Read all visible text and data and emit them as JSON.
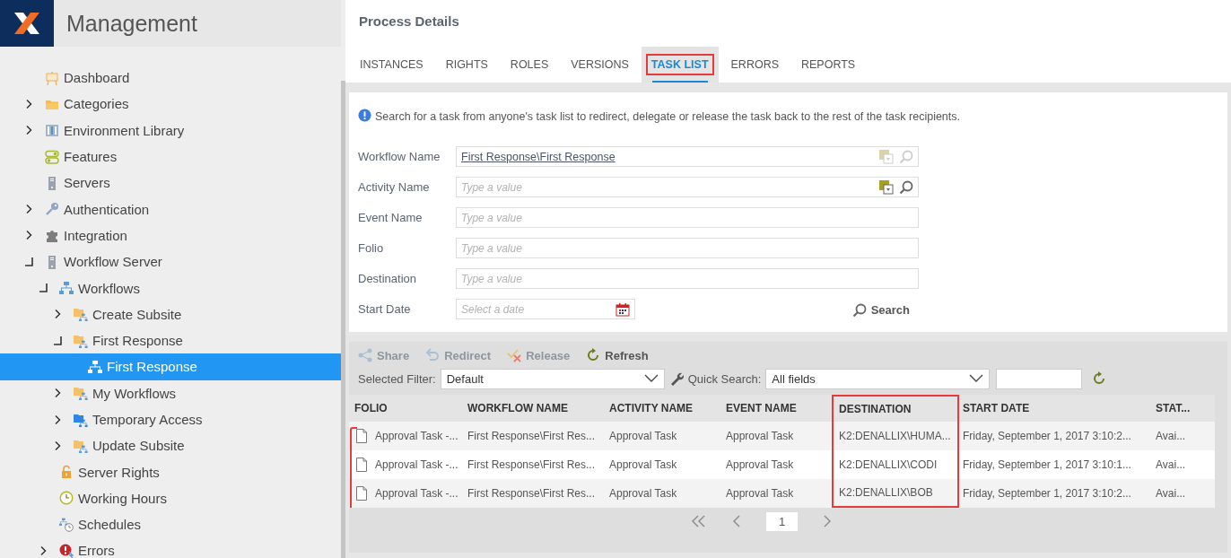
{
  "sidebar": {
    "title": "Management",
    "tree": [
      {
        "label": "Dashboard",
        "kind": "dashboard",
        "selected": false
      },
      {
        "label": "Categories",
        "kind": "folder",
        "selected": false,
        "expanded": false
      },
      {
        "label": "Environment Library",
        "kind": "library",
        "selected": false,
        "expanded": false
      },
      {
        "label": "Features",
        "kind": "toggles",
        "selected": false
      },
      {
        "label": "Servers",
        "kind": "server",
        "selected": false
      },
      {
        "label": "Authentication",
        "kind": "key",
        "selected": false,
        "expanded": false
      },
      {
        "label": "Integration",
        "kind": "puzzle",
        "selected": false,
        "expanded": false
      },
      {
        "label": "Workflow Server",
        "kind": "server",
        "selected": false,
        "expanded": true,
        "children": [
          {
            "label": "Workflows",
            "kind": "workflow",
            "selected": false,
            "expanded": true,
            "children": [
              {
                "label": "Create Subsite",
                "kind": "workflow-folder",
                "selected": false,
                "expanded": false
              },
              {
                "label": "First Response",
                "kind": "workflow-folder",
                "selected": false,
                "expanded": true,
                "children": [
                  {
                    "label": "First Response",
                    "kind": "workflow",
                    "selected": true
                  }
                ]
              },
              {
                "label": "My Workflows",
                "kind": "workflow-folder",
                "selected": false,
                "expanded": false
              },
              {
                "label": "Temporary Access",
                "kind": "workflow-folder-blue",
                "selected": false,
                "expanded": false
              },
              {
                "label": "Update Subsite",
                "kind": "workflow-folder",
                "selected": false,
                "expanded": false
              }
            ]
          },
          {
            "label": "Server Rights",
            "kind": "lock",
            "selected": false
          },
          {
            "label": "Working Hours",
            "kind": "clock",
            "selected": false
          },
          {
            "label": "Schedules",
            "kind": "schedule",
            "selected": false
          },
          {
            "label": "Errors",
            "kind": "error",
            "selected": false,
            "expanded": false
          }
        ]
      }
    ]
  },
  "page": {
    "title": "Process Details"
  },
  "tabs": [
    {
      "label": "INSTANCES",
      "selected": false
    },
    {
      "label": "RIGHTS",
      "selected": false
    },
    {
      "label": "ROLES",
      "selected": false
    },
    {
      "label": "VERSIONS",
      "selected": false
    },
    {
      "label": "TASK LIST",
      "selected": true
    },
    {
      "label": "ERRORS",
      "selected": false
    },
    {
      "label": "REPORTS",
      "selected": false
    }
  ],
  "search_form": {
    "info": "Search for a task from anyone's task list to redirect, delegate or release the task back to the rest of the task recipients.",
    "fields": [
      {
        "label": "Workflow Name",
        "kind": "picker",
        "value": "First Response\\First Response",
        "disabled": true
      },
      {
        "label": "Activity Name",
        "kind": "picker",
        "placeholder": "Type a value",
        "disabled": false
      },
      {
        "label": "Event Name",
        "kind": "text",
        "placeholder": "Type a value"
      },
      {
        "label": "Folio",
        "kind": "text",
        "placeholder": "Type a value"
      },
      {
        "label": "Destination",
        "kind": "text",
        "placeholder": "Type a value"
      },
      {
        "label": "Start Date",
        "kind": "date",
        "placeholder": "Select a date"
      }
    ],
    "search_button": "Search"
  },
  "toolbar": [
    {
      "label": "Share",
      "kind": "share",
      "disabled": true
    },
    {
      "label": "Redirect",
      "kind": "redirect",
      "disabled": true
    },
    {
      "label": "Release",
      "kind": "release",
      "disabled": true
    },
    {
      "label": "Refresh",
      "kind": "refresh",
      "disabled": false
    }
  ],
  "filter": {
    "label": "Selected Filter:",
    "value": "Default",
    "quick_search_label": "Quick Search:",
    "quick_search_value": "All fields"
  },
  "table": {
    "rows_bracketed": true,
    "columns": [
      {
        "label": "FOLIO",
        "highlighted": false
      },
      {
        "label": "WORKFLOW NAME",
        "highlighted": false
      },
      {
        "label": "ACTIVITY NAME",
        "highlighted": false
      },
      {
        "label": "EVENT NAME",
        "highlighted": false
      },
      {
        "label": "DESTINATION",
        "highlighted": true
      },
      {
        "label": "START DATE",
        "highlighted": false
      },
      {
        "label": "STAT...",
        "highlighted": false
      }
    ],
    "rows": [
      [
        "Approval Task -...",
        "First Response\\First Res...",
        "Approval Task",
        "Approval Task",
        "K2:DENALLIX\\HUMA...",
        "Friday, September 1, 2017 3:10:2...",
        "Avai..."
      ],
      [
        "Approval Task -...",
        "First Response\\First Res...",
        "Approval Task",
        "Approval Task",
        "K2:DENALLIX\\CODI",
        "Friday, September 1, 2017 3:10:1...",
        "Avai..."
      ],
      [
        "Approval Task -...",
        "First Response\\First Res...",
        "Approval Task",
        "Approval Task",
        "K2:DENALLIX\\BOB",
        "Friday, September 1, 2017 3:10:2...",
        "Avai..."
      ]
    ]
  },
  "pagination": {
    "page": "1"
  }
}
